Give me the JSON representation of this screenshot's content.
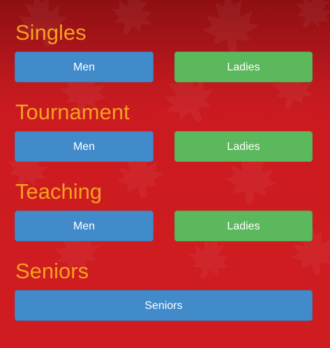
{
  "sections": [
    {
      "title": "Singles",
      "buttons": [
        "Men",
        "Ladies"
      ]
    },
    {
      "title": "Tournament",
      "buttons": [
        "Men",
        "Ladies"
      ]
    },
    {
      "title": "Teaching",
      "buttons": [
        "Men",
        "Ladies"
      ]
    },
    {
      "title": "Seniors",
      "buttons": [
        "Seniors"
      ]
    }
  ],
  "colors": {
    "background": "#cf1c21",
    "title": "#f6a01f",
    "men_button": "#428bca",
    "ladies_button": "#5cb85c"
  }
}
